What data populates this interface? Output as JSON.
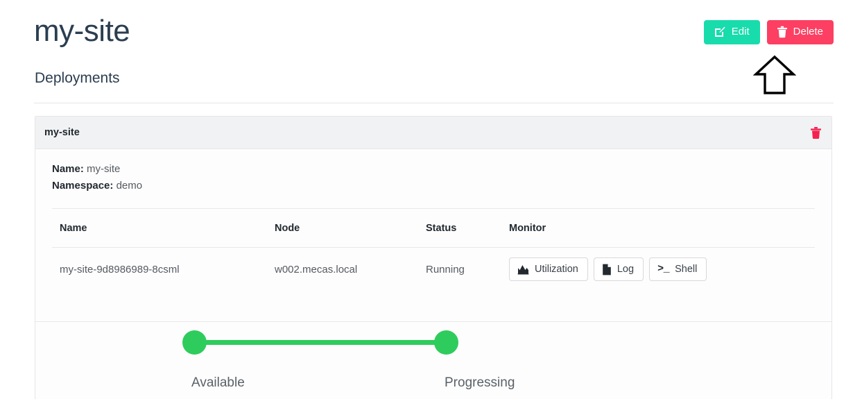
{
  "header": {
    "title": "my-site",
    "subtitle": "Deployments",
    "actions": [
      {
        "label": "Edit",
        "icon": "edit-square-icon",
        "color": "#18dcac"
      },
      {
        "label": "Delete",
        "icon": "trash-icon",
        "color": "#fc3f62"
      }
    ]
  },
  "annotation": {
    "shape": "up-arrow-outline",
    "color": "#000000",
    "points_at": "Delete"
  },
  "card": {
    "header_title": "my-site",
    "header_action_icon": "trash-icon",
    "header_action_color": "#f5214f",
    "meta": [
      {
        "label": "Name:",
        "value": "my-site"
      },
      {
        "label": "Namespace:",
        "value": "demo"
      }
    ],
    "table": {
      "columns": [
        "Name",
        "Node",
        "Status",
        "Monitor"
      ],
      "rows": [
        {
          "name": "my-site-9d8986989-8csml",
          "node": "w002.mecas.local",
          "status": "Running",
          "monitor": [
            {
              "label": "Utilization",
              "icon": "chart-area-icon"
            },
            {
              "label": "Log",
              "icon": "file-icon"
            },
            {
              "label": "Shell",
              "icon": "terminal-icon"
            }
          ]
        }
      ]
    },
    "pipeline": {
      "color": "#2ecc5d",
      "nodes": [
        {
          "label": "Available",
          "state": "done"
        },
        {
          "label": "Progressing",
          "state": "done"
        }
      ]
    }
  }
}
